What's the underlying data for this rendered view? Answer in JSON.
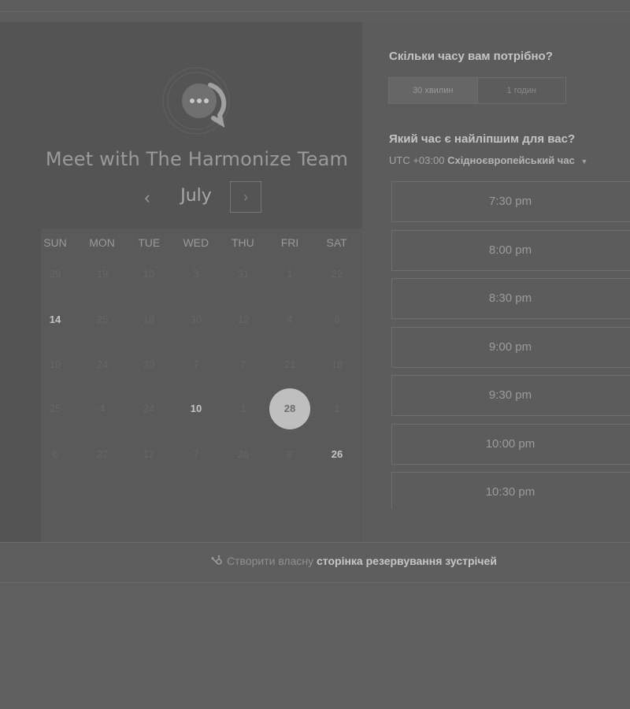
{
  "booking": {
    "title": "Meet with The Harmonize Team",
    "logo_icon": "chat-bubble-icon"
  },
  "calendar": {
    "month": "July",
    "prev_icon": "‹",
    "next_icon": "›",
    "weekdays": [
      "SUN",
      "MON",
      "TUE",
      "WED",
      "THU",
      "FRI",
      "SAT"
    ],
    "weeks": [
      [
        {
          "d": "29",
          "s": "off"
        },
        {
          "d": "19",
          "s": "off"
        },
        {
          "d": "10",
          "s": "off"
        },
        {
          "d": "3",
          "s": "off"
        },
        {
          "d": "31",
          "s": "off"
        },
        {
          "d": "1",
          "s": "off"
        },
        {
          "d": "22",
          "s": "off"
        }
      ],
      [
        {
          "d": "14",
          "s": "avail"
        },
        {
          "d": "25",
          "s": "off"
        },
        {
          "d": "16",
          "s": "off"
        },
        {
          "d": "30",
          "s": "off"
        },
        {
          "d": "12",
          "s": "off"
        },
        {
          "d": "4",
          "s": "off"
        },
        {
          "d": "6",
          "s": "off"
        }
      ],
      [
        {
          "d": "10",
          "s": "off"
        },
        {
          "d": "24",
          "s": "off"
        },
        {
          "d": "30",
          "s": "off"
        },
        {
          "d": "7",
          "s": "off"
        },
        {
          "d": "7",
          "s": "off"
        },
        {
          "d": "21",
          "s": "off"
        },
        {
          "d": "18",
          "s": "off"
        }
      ],
      [
        {
          "d": "25",
          "s": "off"
        },
        {
          "d": "4",
          "s": "off"
        },
        {
          "d": "24",
          "s": "off"
        },
        {
          "d": "10",
          "s": "avail"
        },
        {
          "d": "1",
          "s": "off"
        },
        {
          "d": "28",
          "s": "selected"
        },
        {
          "d": "1",
          "s": "off"
        }
      ],
      [
        {
          "d": "6",
          "s": "off"
        },
        {
          "d": "27",
          "s": "off"
        },
        {
          "d": "12",
          "s": "off"
        },
        {
          "d": "7",
          "s": "off"
        },
        {
          "d": "26",
          "s": "off"
        },
        {
          "d": "8",
          "s": "off"
        },
        {
          "d": "26",
          "s": "avail"
        }
      ]
    ]
  },
  "duration": {
    "question": "Скільки часу вам потрібно?",
    "options": [
      "30 хвилин",
      "1 годин"
    ],
    "selected": "30 хвилин"
  },
  "time": {
    "question": "Який час є найліпшим для вас?",
    "timezone_prefix": "UTC +03:00",
    "timezone_name": "Східноєвропейський час",
    "slots": [
      "7:30 pm",
      "8:00 pm",
      "8:30 pm",
      "9:00 pm",
      "9:30 pm",
      "10:00 pm",
      "10:30 pm"
    ]
  },
  "footer": {
    "text": "Створити власну",
    "link": "сторінка резервування зустрічей",
    "icon": "sprocket-icon"
  }
}
